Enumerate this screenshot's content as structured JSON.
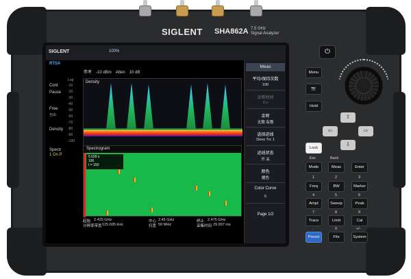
{
  "device": {
    "brand": "SIGLENT",
    "model": "SHA862A",
    "model_desc_1": "7.5 GHz",
    "model_desc_2": "Signal Analyzer"
  },
  "screen": {
    "logo": "SIGLENT",
    "battery": "100%",
    "mode": "RTSA",
    "ref_label": "参考",
    "ref_value": "-10 dBm",
    "atten_label": "Atten",
    "atten_value": "10 dB",
    "left_labels": {
      "cont": "Cont",
      "pause": "Pause",
      "free": "Free",
      "free_sub": "自由",
      "density": "Density",
      "spectr": "Spectr",
      "spectr_sub": "1  On  P"
    },
    "density_title": "Density",
    "density_scale": "Log",
    "y_ticks": [
      "-10",
      "-20",
      "-30",
      "-40",
      "-50",
      "-60",
      "-70",
      "-80",
      "-90",
      "-100"
    ],
    "spectrogram_title": "Spectrogram",
    "spectrogram_box": [
      "5.699 s",
      "190",
      "t = 150"
    ],
    "bottom": {
      "start_label": "起始",
      "start_value": "2.425 GHz",
      "rbw_label": "分辨率带宽",
      "rbw_value": "125.695 kHz",
      "center_label": "中心",
      "center_value": "2.45 GHz",
      "span_label": "扫宽",
      "span_value": "50 MHz",
      "stop_label": "终止",
      "stop_value": "2.475 GHz",
      "acq_label": "采集时间",
      "acq_value": "29.997 ms"
    }
  },
  "menu": {
    "header": "Meas",
    "avg_label": "平均/保持次数",
    "avg_value": "100",
    "persist_label": "余辉时间",
    "persist_value": "0 s",
    "afterglow_label": "余辉",
    "afterglow_value": "无限  有限",
    "select_trace_label": "选择迹线",
    "select_trace_value": "Dens Trc 1",
    "trace_state_label": "迹线状态",
    "trace_state_value": "开  关",
    "color_label": "颜色",
    "color_value": "暖色",
    "color_curve_label": "Color Curve",
    "color_curve_value": "5",
    "page": "Page 1/2"
  },
  "keys": {
    "power": "⏻",
    "menu": "Menu",
    "camera": "📷",
    "hold": "Hold",
    "lock": "Lock",
    "esc_sub": "Esc",
    "back_sub": "Back",
    "mode": "Mode",
    "meas": "Meas",
    "enter": "Enter",
    "num_sub_1": "1",
    "num_sub_2": "2",
    "num_sub_3": "3",
    "freq": "Freq",
    "bw": "BW",
    "marker": "Marker",
    "num_sub_4": "4",
    "num_sub_5": "5",
    "num_sub_6": "6",
    "ampt": "Ampt",
    "sweep": "Sweep",
    "peak": "Peak",
    "num_sub_7": "7",
    "num_sub_8": "8",
    "num_sub_9": "9",
    "trace": "Trace",
    "limit": "Limit",
    "cal": "Cal",
    "num_sub_dot": ".",
    "num_sub_0": "0",
    "num_sub_pm": "+/-",
    "preset": "Preset",
    "file": "File",
    "system": "System"
  }
}
